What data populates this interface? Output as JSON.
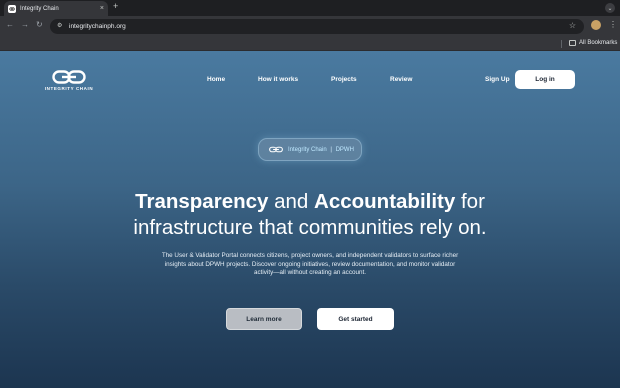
{
  "browser": {
    "tab_title": "Integrity Chain",
    "tab_close": "×",
    "new_tab": "+",
    "url": "integritychainph.org",
    "bookmarks_label": "All Bookmarks",
    "icons": [
      "back-icon",
      "forward-icon",
      "reload-icon",
      "site-info-icon",
      "star-icon",
      "kebab-menu-icon",
      "folder-icon"
    ]
  },
  "site": {
    "logo_text": "INTEGRITY CHAIN",
    "nav": [
      "Home",
      "How it works",
      "Projects",
      "Review"
    ],
    "signup_label": "Sign Up",
    "login_label": "Log in"
  },
  "hero": {
    "badge_name": "Integrity Chain",
    "badge_sep": "|",
    "badge_tag": "DPWH",
    "headline_strong1": "Transparency",
    "headline_mid1": " and ",
    "headline_strong2": "Accountability",
    "headline_mid2": " for",
    "headline_line2": "infrastructure that communities rely on.",
    "description": "The User & Validator Portal connects citizens, project owners, and independent validators to surface richer insights about DPWH projects. Discover ongoing initiatives, review documentation, and monitor validator activity—all without creating an account.",
    "learn_more": "Learn more",
    "get_started": "Get started"
  },
  "colors": {
    "accent_badge_text": "#bfe8ff",
    "page_top": "#4a7aa0",
    "page_bottom": "#1c3550"
  }
}
